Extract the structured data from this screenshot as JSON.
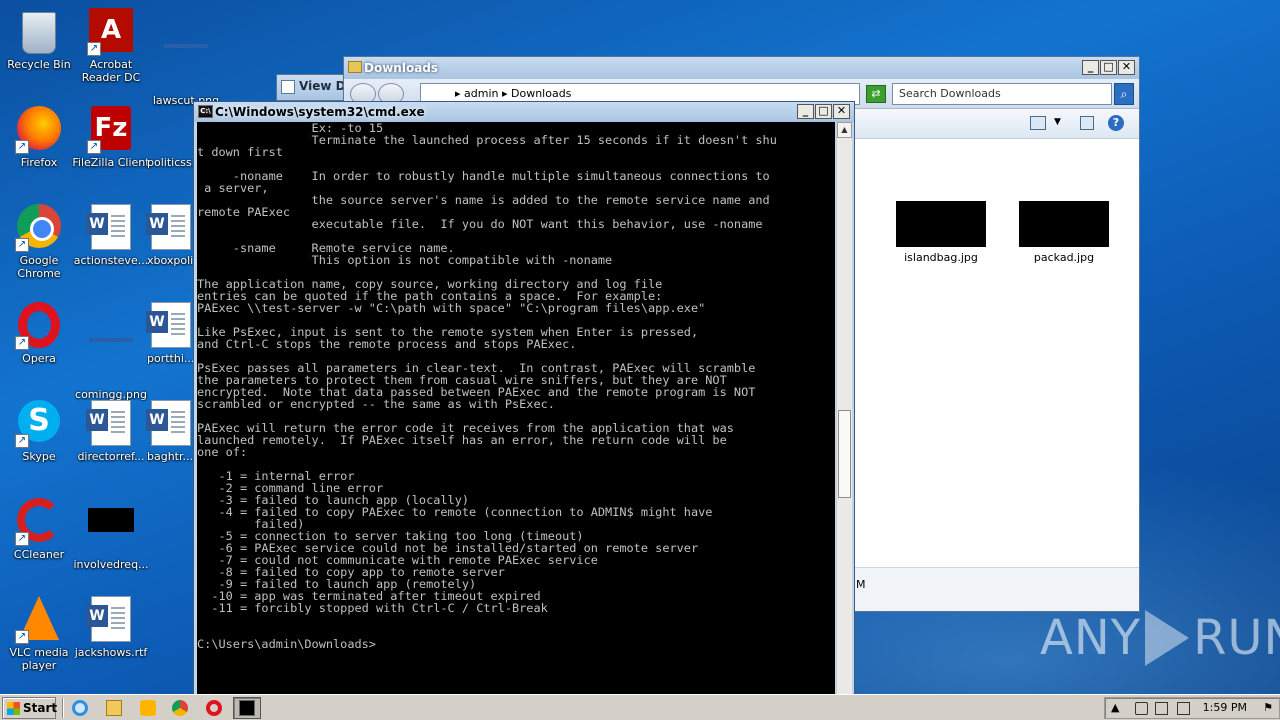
{
  "desktop": {
    "icons": [
      {
        "label": "Recycle Bin",
        "icon": "recycle-bin-icon"
      },
      {
        "label": "Acrobat Reader DC",
        "icon": "acrobat-icon"
      },
      {
        "label": "lawscut.png",
        "icon": "image-file-icon"
      },
      {
        "label": "Firefox",
        "icon": "firefox-icon"
      },
      {
        "label": "FileZilla Client",
        "icon": "filezilla-icon"
      },
      {
        "label": "politicss...",
        "icon": "image-file-icon"
      },
      {
        "label": "Google Chrome",
        "icon": "chrome-icon"
      },
      {
        "label": "actionsteve...",
        "icon": "word-doc-icon"
      },
      {
        "label": "xboxpoli...",
        "icon": "word-doc-icon"
      },
      {
        "label": "Opera",
        "icon": "opera-icon"
      },
      {
        "label": "comingg.png",
        "icon": "image-file-icon"
      },
      {
        "label": "portthi...",
        "icon": "word-doc-icon"
      },
      {
        "label": "Skype",
        "icon": "skype-icon"
      },
      {
        "label": "directorref...",
        "icon": "word-doc-icon"
      },
      {
        "label": "baghtr...",
        "icon": "word-doc-icon"
      },
      {
        "label": "CCleaner",
        "icon": "ccleaner-icon"
      },
      {
        "label": "involvedreq...",
        "icon": "image-file-icon"
      },
      {
        "label": "VLC media player",
        "icon": "vlc-icon"
      },
      {
        "label": "jackshows.rtf",
        "icon": "word-doc-icon"
      }
    ]
  },
  "back_window": {
    "title": "View Do"
  },
  "explorer": {
    "title": "Downloads",
    "address": "▸ admin ▸ Downloads",
    "search_placeholder": "Search Downloads",
    "files": [
      {
        "name": "islandbag.jpg"
      },
      {
        "name": "packad.jpg"
      }
    ],
    "status_fragment": "M"
  },
  "cmd": {
    "title": "C:\\Windows\\system32\\cmd.exe",
    "lines": [
      "                Ex: -to 15",
      "                Terminate the launched process after 15 seconds if it doesn't shu",
      "t down first",
      "",
      "     -noname    In order to robustly handle multiple simultaneous connections to",
      " a server,",
      "                the source server's name is added to the remote service name and",
      "remote PAExec",
      "                executable file.  If you do NOT want this behavior, use -noname",
      "",
      "     -sname     Remote service name.",
      "                This option is not compatible with -noname",
      "",
      "The application name, copy source, working directory and log file",
      "entries can be quoted if the path contains a space.  For example:",
      "PAExec \\\\test-server -w \"C:\\path with space\" \"C:\\program files\\app.exe\"",
      "",
      "Like PsExec, input is sent to the remote system when Enter is pressed,",
      "and Ctrl-C stops the remote process and stops PAExec.",
      "",
      "PsExec passes all parameters in clear-text.  In contrast, PAExec will scramble",
      "the parameters to protect them from casual wire sniffers, but they are NOT",
      "encrypted.  Note that data passed between PAExec and the remote program is NOT",
      "scrambled or encrypted -- the same as with PsExec.",
      "",
      "PAExec will return the error code it receives from the application that was",
      "launched remotely.  If PAExec itself has an error, the return code will be",
      "one of:",
      "",
      "   -1 = internal error",
      "   -2 = command line error",
      "   -3 = failed to launch app (locally)",
      "   -4 = failed to copy PAExec to remote (connection to ADMIN$ might have",
      "        failed)",
      "   -5 = connection to server taking too long (timeout)",
      "   -6 = PAExec service could not be installed/started on remote server",
      "   -7 = could not communicate with remote PAExec service",
      "   -8 = failed to copy app to remote server",
      "   -9 = failed to launch app (remotely)",
      "  -10 = app was terminated after timeout expired",
      "  -11 = forcibly stopped with Ctrl-C / Ctrl-Break",
      "",
      "",
      "C:\\Users\\admin\\Downloads>"
    ]
  },
  "watermark": {
    "left": "ANY",
    "right": "RUN"
  },
  "taskbar": {
    "start_label": "Start",
    "clock": "1:59 PM",
    "apps": [
      {
        "name": "ie-icon"
      },
      {
        "name": "explorer-icon"
      },
      {
        "name": "media-player-icon"
      },
      {
        "name": "chrome-icon"
      },
      {
        "name": "opera-icon"
      },
      {
        "name": "cmd-icon"
      }
    ]
  }
}
